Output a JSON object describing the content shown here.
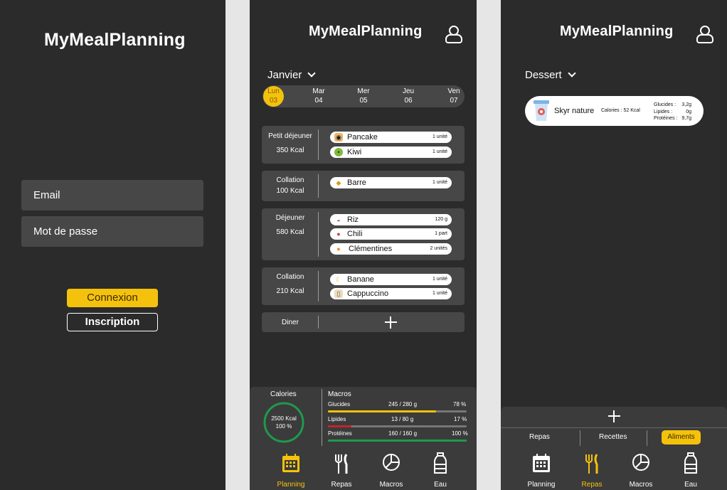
{
  "app_name": "MyMealPlanning",
  "login": {
    "email_placeholder": "Email",
    "password_placeholder": "Mot de passe",
    "login_button": "Connexion",
    "register_button": "Inscription"
  },
  "planning": {
    "month": "Janvier",
    "days": [
      {
        "name": "Lun",
        "num": "03",
        "active": true
      },
      {
        "name": "Mar",
        "num": "04"
      },
      {
        "name": "Mer",
        "num": "05"
      },
      {
        "name": "Jeu",
        "num": "06"
      },
      {
        "name": "Ven",
        "num": "07"
      }
    ],
    "meals": [
      {
        "name": "Petit déjeuner",
        "kcal": "350 Kcal",
        "items": [
          {
            "name": "Pancake",
            "qty": "1 unité",
            "icon": "pancake-icon"
          },
          {
            "name": "Kiwi",
            "qty": "1 unité",
            "icon": "kiwi-icon"
          }
        ]
      },
      {
        "name": "Collation",
        "kcal": "100 Kcal",
        "items": [
          {
            "name": "Barre",
            "qty": "1 unité",
            "icon": "bar-icon"
          }
        ]
      },
      {
        "name": "Déjeuner",
        "kcal": "580 Kcal",
        "items": [
          {
            "name": "Riz",
            "qty": "120 g",
            "icon": "rice-icon"
          },
          {
            "name": "Chili",
            "qty": "1 part",
            "icon": "chili-icon"
          },
          {
            "name": "Clémentines",
            "qty": "2 unités",
            "icon": "clementine-icon"
          }
        ]
      },
      {
        "name": "Collation",
        "kcal": "210 Kcal",
        "items": [
          {
            "name": "Banane",
            "qty": "1 unité",
            "icon": "banana-icon"
          },
          {
            "name": "Cappuccino",
            "qty": "1 unité",
            "icon": "cappuccino-icon"
          }
        ]
      },
      {
        "name": "Diner",
        "kcal": "",
        "items": []
      }
    ],
    "calories": {
      "label": "Calories",
      "value": "2500 Kcal",
      "percent": "100 %"
    },
    "macros": {
      "label": "Macros",
      "rows": [
        {
          "name": "Glucides",
          "value": "245 / 280 g",
          "percent": "78 %",
          "fraction": 0.78,
          "color": "#f4c20d"
        },
        {
          "name": "Lipides",
          "value": "13 / 80 g",
          "percent": "17 %",
          "fraction": 0.17,
          "color": "#c0262c"
        },
        {
          "name": "Protéines",
          "value": "160 / 160 g",
          "percent": "100 %",
          "fraction": 1.0,
          "color": "#1e9a4c"
        }
      ]
    }
  },
  "nav": {
    "planning": "Planning",
    "repas": "Repas",
    "macros": "Macros",
    "eau": "Eau"
  },
  "aliments": {
    "category": "Dessert",
    "food": {
      "name": "Skyr nature",
      "calories": "Calories : 52 Kcal",
      "glucides_label": "Glucides :",
      "glucides": "3,2g",
      "lipides_label": "Lipides :",
      "lipides": "0g",
      "proteines_label": "Protéines :",
      "proteines": "9,7g"
    },
    "tabs": {
      "repas": "Repas",
      "recettes": "Recettes",
      "aliments": "Aliments"
    }
  },
  "colors": {
    "accent": "#f4c20d",
    "background": "#2b2b2b",
    "panel": "#474747",
    "success": "#1e9a4c"
  }
}
